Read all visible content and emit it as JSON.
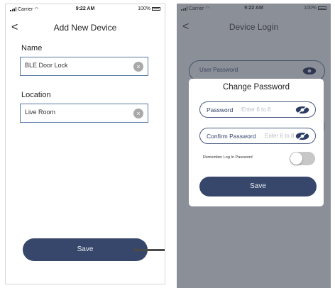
{
  "left_screen": {
    "status": {
      "carrier": "Carrier",
      "time": "9:22 AM",
      "battery": "100%"
    },
    "nav": {
      "back_icon": "chevron-left-icon",
      "back_glyph": "<",
      "title": "Add New Device"
    },
    "name_field": {
      "label": "Name",
      "value": "BLE Door Lock"
    },
    "location_field": {
      "label": "Location",
      "value": "Live Room"
    },
    "clear_glyph": "×",
    "save_label": "Save"
  },
  "right_screen": {
    "status": {
      "carrier": "Carrier",
      "time": "9:22 AM",
      "battery": "100%"
    },
    "nav": {
      "back_icon": "chevron-left-icon",
      "back_glyph": "<",
      "title": "Device Login"
    },
    "background_field_label": "User Password",
    "modal": {
      "title": "Change Password",
      "password_label": "Password",
      "password_placeholder": "Enter 6 to 8",
      "confirm_label": "Confirm Password",
      "confirm_placeholder": "Enter 6 to 8",
      "remember_label": "Remember Log In Password",
      "remember_on": false,
      "save_label": "Save"
    }
  },
  "colors": {
    "accent": "#36476b",
    "field_border": "#5a79a6",
    "overlay": "#8b8f98"
  }
}
